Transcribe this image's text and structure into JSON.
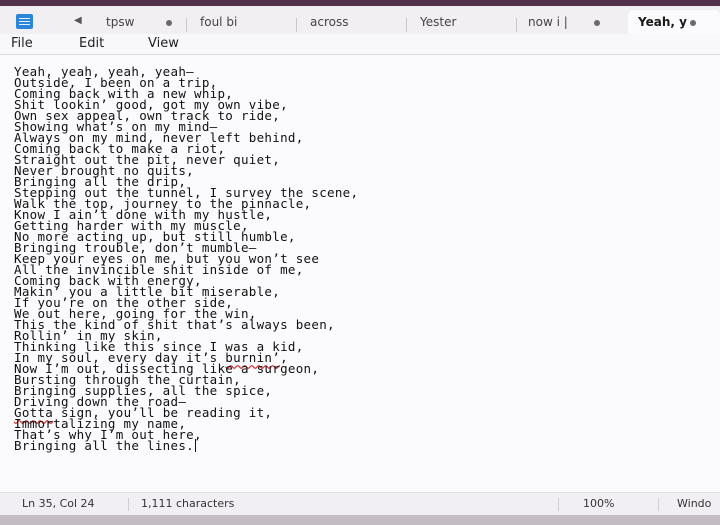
{
  "tabs": [
    {
      "label": "tpsw",
      "has_dot": true
    },
    {
      "label": "foul bi",
      "has_dot": false
    },
    {
      "label": "across",
      "has_dot": false
    },
    {
      "label": "Yester",
      "has_dot": false
    },
    {
      "label": "now i |",
      "has_dot": true
    },
    {
      "label": "Yeah, y",
      "has_dot": true,
      "active": true
    }
  ],
  "menu": {
    "file": "File",
    "edit": "Edit",
    "view": "View"
  },
  "editor": {
    "lines": [
      "Yeah, yeah, yeah, yeah—",
      "Outside, I been on a trip,",
      "Coming back with a new whip,",
      "Shit lookin’ good, got my own vibe,",
      "Own sex appeal, own track to ride,",
      "Showing what’s on my mind—",
      "Always on my mind, never left behind,",
      "Coming back to make a riot,",
      "Straight out the pit, never quiet,",
      "Never brought no quits,",
      "Bringing all the drip,",
      "Stepping out the tunnel, I survey the scene,",
      "Walk the top, journey to the pinnacle,",
      "Know I ain’t done with my hustle,",
      "Getting harder with my muscle,",
      "No more acting up, but still humble,",
      "Bringing trouble, don’t mumble—",
      "Keep your eyes on me, but you won’t see",
      "All the invincible shit inside of me,",
      "Coming back with energy,",
      "Makin’ you a little bit miserable,",
      "If you’re on the other side,",
      "We out here, going for the win,",
      "This the kind of shit that’s always been,",
      "Rollin’ in my skin,",
      "Thinking like this since I was a kid,",
      "In my soul, every day it’s ",
      "Now I’m out, dissecting like a surgeon,",
      "Bursting through the curtain,",
      "Bringing supplies, all the spice,",
      "Driving down the road—",
      " sign, you’ll be reading it,",
      "Immortalizing my name,",
      "That’s why I’m out here,",
      "Bringing all the lines."
    ],
    "misspelled_1": "burnin’",
    "line27_tail": ",",
    "misspelled_2": "Gotta"
  },
  "status": {
    "position": "Ln 35, Col 24",
    "characters": "1,111 characters",
    "zoom": "100%",
    "line_ending": "Windo"
  },
  "colors": {
    "title_strip": "#52304a",
    "editor_bg": "#fbfbfd",
    "spell_underline": "#d23a3a"
  }
}
